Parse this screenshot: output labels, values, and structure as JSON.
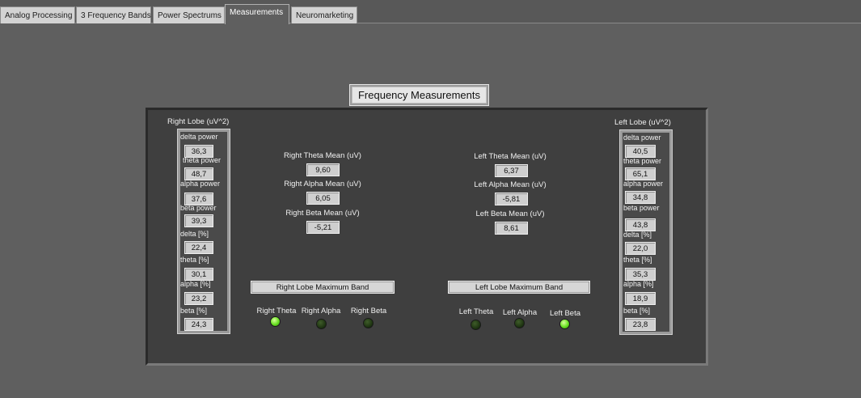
{
  "tabs": [
    {
      "label": "Analog Processing",
      "active": false
    },
    {
      "label": "3 Frequency Bands",
      "active": false
    },
    {
      "label": "Power Spectrums",
      "active": false
    },
    {
      "label": "Measurements",
      "active": true
    },
    {
      "label": "Neuromarketing",
      "active": false
    }
  ],
  "title": "Frequency Measurements",
  "right_lobe": {
    "label": "Right Lobe  (uV^2)",
    "fields": [
      {
        "label": "delta power",
        "value": "36,3"
      },
      {
        "label": "theta power",
        "value": "48,7"
      },
      {
        "label": "alpha power",
        "value": "37,6"
      },
      {
        "label": "beta power",
        "value": "39,3"
      },
      {
        "label": "delta [%]",
        "value": "22,4"
      },
      {
        "label": "theta [%]",
        "value": "30,1"
      },
      {
        "label": "alpha [%]",
        "value": "23,2"
      },
      {
        "label": "beta [%]",
        "value": "24,3"
      }
    ]
  },
  "left_lobe": {
    "label": "Left Lobe  (uV^2)",
    "fields": [
      {
        "label": "delta power",
        "value": "40,5"
      },
      {
        "label": "theta power",
        "value": "65,1"
      },
      {
        "label": "alpha power",
        "value": "34,8"
      },
      {
        "label": "beta power",
        "value": "43,8"
      },
      {
        "label": "delta [%]",
        "value": "22,0"
      },
      {
        "label": "theta [%]",
        "value": "35,3"
      },
      {
        "label": "alpha [%]",
        "value": "18,9"
      },
      {
        "label": "beta [%]",
        "value": "23,8"
      }
    ]
  },
  "right_means": [
    {
      "label": "Right Theta Mean (uV)",
      "value": "9,60"
    },
    {
      "label": "Right Alpha Mean (uV)",
      "value": "6,05"
    },
    {
      "label": "Right Beta Mean (uV)",
      "value": "-5,21"
    }
  ],
  "left_means": [
    {
      "label": "Left Theta Mean (uV)",
      "value": "6,37"
    },
    {
      "label": "Left Alpha Mean (uV)",
      "value": "-5,81"
    },
    {
      "label": "Left Beta Mean (uV)",
      "value": "8,61"
    }
  ],
  "right_max_band": {
    "label": "Right Lobe Maximum Band",
    "leds": [
      {
        "label": "Right Theta",
        "on": true
      },
      {
        "label": "Right Alpha",
        "on": false
      },
      {
        "label": "Right Beta",
        "on": false
      }
    ]
  },
  "left_max_band": {
    "label": "Left Lobe Maximum Band",
    "leds": [
      {
        "label": "Left Theta",
        "on": false
      },
      {
        "label": "Left Alpha",
        "on": false
      },
      {
        "label": "Left Beta",
        "on": true
      }
    ]
  },
  "colors": {
    "background": "#5f5f5f",
    "panel": "#3f3f3f",
    "led_on": "#66e020",
    "led_off": "#1d3311"
  }
}
